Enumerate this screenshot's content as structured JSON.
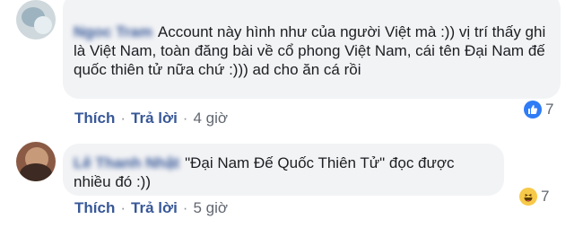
{
  "comments": [
    {
      "author": "Ngoc Tram",
      "text": "Account này hình như của người Việt mà :)) vị trí thấy ghi là Việt Nam, toàn đăng bài về cổ phong Việt Nam, cái tên Đại Nam đế quốc thiên tử nữa chứ :))) ad cho ăn cá rồi",
      "actions": {
        "like": "Thích",
        "reply": "Trả lời",
        "time": "4 giờ"
      },
      "reaction": {
        "icon": "like-icon",
        "count": "7"
      }
    },
    {
      "author": "Lê Thanh Nhật",
      "text": "\"Đại Nam Đế Quốc Thiên Tử\" đọc được nhiều đó :))",
      "actions": {
        "like": "Thích",
        "reply": "Trả lời",
        "time": "5 giờ"
      },
      "reaction": {
        "icon": "haha-icon",
        "count": "7"
      }
    }
  ],
  "separator": "·",
  "colors": {
    "bubble": "#f2f3f5",
    "link": "#385898",
    "like": "#2e7cf6",
    "haha": "#f7c948"
  }
}
